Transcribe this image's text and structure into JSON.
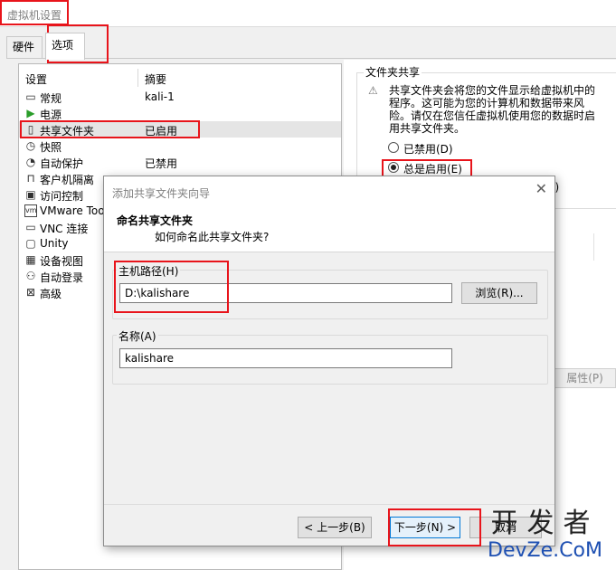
{
  "window": {
    "title": "虚拟机设置"
  },
  "tabs": [
    {
      "label": "硬件"
    },
    {
      "label": "选项"
    }
  ],
  "settings_list": {
    "headers": {
      "setting": "设置",
      "summary": "摘要"
    },
    "items": [
      {
        "icon": "general-icon",
        "glyph": "▭",
        "name": "常规",
        "summary": "kali-1"
      },
      {
        "icon": "power-icon",
        "glyph": "▶",
        "name": "电源",
        "summary": ""
      },
      {
        "icon": "shared-folder-icon",
        "glyph": "▯",
        "name": "共享文件夹",
        "summary": "已启用"
      },
      {
        "icon": "snapshot-icon",
        "glyph": "◷",
        "name": "快照",
        "summary": ""
      },
      {
        "icon": "autoprotect-icon",
        "glyph": "◔",
        "name": "自动保护",
        "summary": "已禁用"
      },
      {
        "icon": "lock-icon",
        "glyph": "⊓",
        "name": "客户机隔离",
        "summary": ""
      },
      {
        "icon": "access-control-icon",
        "glyph": "▣",
        "name": "访问控制",
        "summary": ""
      },
      {
        "icon": "vmware-tools-icon",
        "glyph": "vm",
        "name": "VMware Too",
        "summary": ""
      },
      {
        "icon": "vnc-icon",
        "glyph": "▭",
        "name": "VNC 连接",
        "summary": ""
      },
      {
        "icon": "unity-icon",
        "glyph": "▢",
        "name": "Unity",
        "summary": ""
      },
      {
        "icon": "device-view-icon",
        "glyph": "▦",
        "name": "设备视图",
        "summary": ""
      },
      {
        "icon": "autologin-icon",
        "glyph": "⚇",
        "name": "自动登录",
        "summary": ""
      },
      {
        "icon": "advanced-icon",
        "glyph": "⊠",
        "name": "高级",
        "summary": ""
      }
    ]
  },
  "shared_folders": {
    "title": "文件夹共享",
    "warning": "共享文件夹会将您的文件显示给虚拟机中的程序。这可能为您的计算机和数据带来风险。请仅在您信任虚拟机使用您的数据时启用共享文件夹。",
    "options": [
      {
        "label": "已禁用(D)",
        "selected": false
      },
      {
        "label": "总是启用(E)",
        "selected": true
      }
    ],
    "peek_text": "J)",
    "properties_button": "属性(P)"
  },
  "dialog": {
    "title": "添加共享文件夹向导",
    "heading": "命名共享文件夹",
    "subheading": "如何命名此共享文件夹?",
    "host_path": {
      "label": "主机路径(H)",
      "value": "D:\\kalishare",
      "browse_button": "浏览(R)..."
    },
    "name": {
      "label": "名称(A)",
      "value": "kalishare"
    },
    "buttons": {
      "back": "< 上一步(B)",
      "next": "下一步(N) >",
      "cancel": "取消"
    }
  },
  "watermark": {
    "cn": "开发者",
    "en": "DevZe.CoM"
  },
  "colors": {
    "highlight": "#e8141b",
    "watermark_blue": "#1d4fb2"
  }
}
